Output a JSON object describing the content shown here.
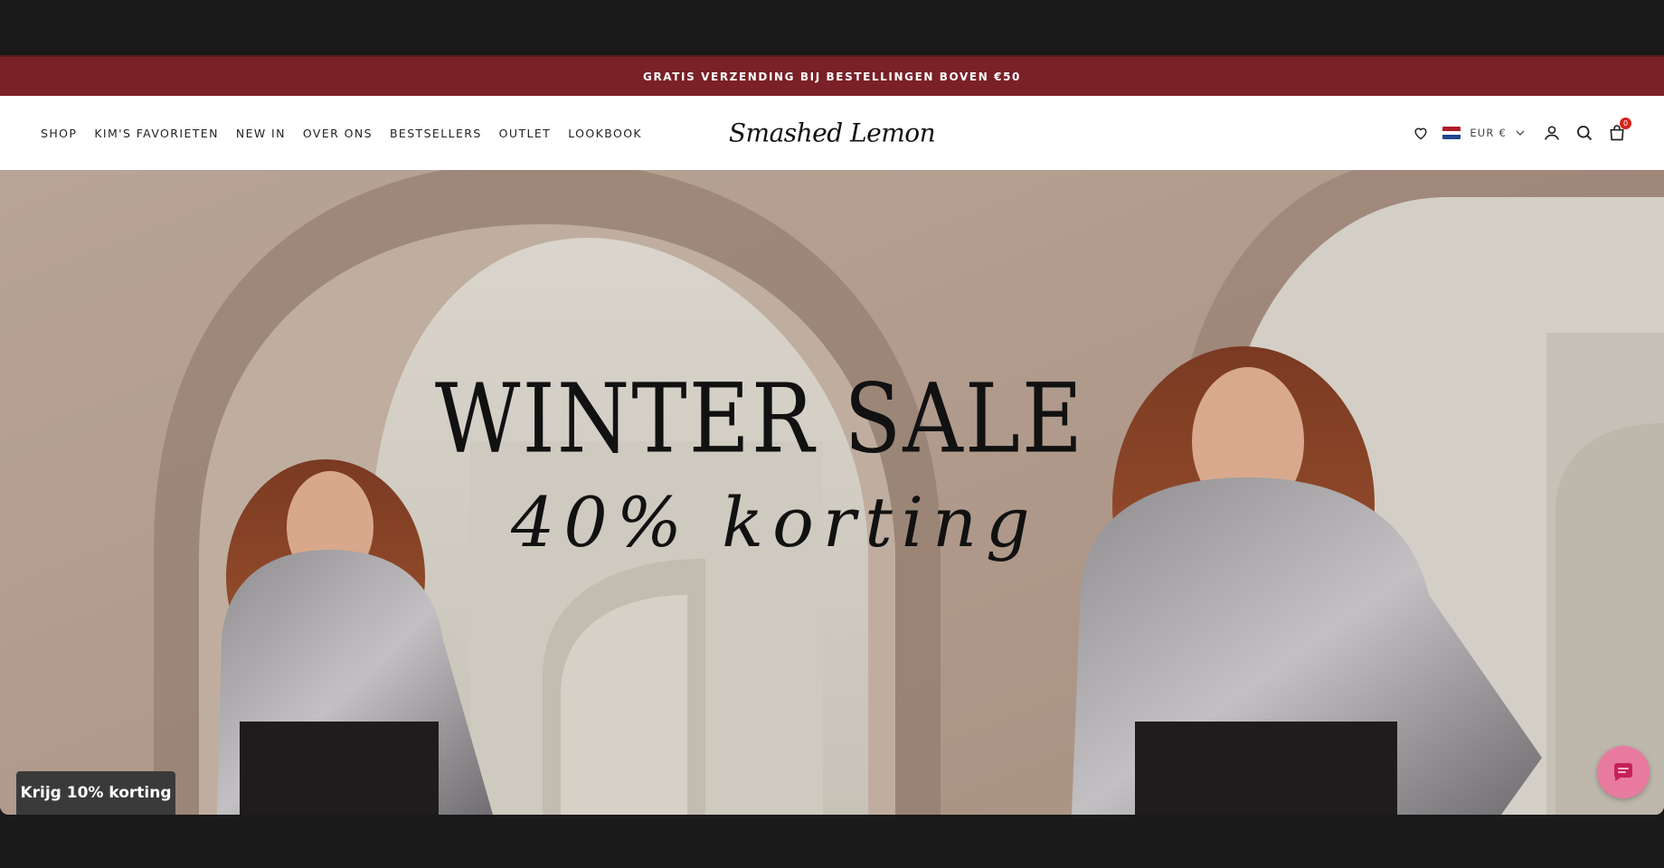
{
  "announcement": {
    "text": "GRATIS VERZENDING BIJ BESTELLINGEN BOVEN €50"
  },
  "nav": {
    "items": [
      {
        "label": "SHOP"
      },
      {
        "label": "KIM'S FAVORIETEN"
      },
      {
        "label": "NEW IN"
      },
      {
        "label": "OVER ONS"
      },
      {
        "label": "BESTSELLERS"
      },
      {
        "label": "OUTLET"
      },
      {
        "label": "LOOKBOOK"
      }
    ]
  },
  "brand": {
    "logo_text": "Smashed Lemon"
  },
  "tools": {
    "wishlist_icon": "heart-icon",
    "currency_label": "EUR €",
    "flag": "netherlands-flag",
    "account_icon": "user-icon",
    "search_icon": "search-icon",
    "cart_icon": "bag-icon",
    "cart_count": "0"
  },
  "hero": {
    "title": "WINTER SALE",
    "subtitle": "40% korting"
  },
  "promo_tab": {
    "label": "Krijg 10% korting"
  },
  "chat": {
    "icon": "chat-icon"
  },
  "colors": {
    "announcement_bg": "#7a2027",
    "badge": "#d4241c",
    "chat_bg": "#e87aa0",
    "promo_bg": "#3a3a3a"
  }
}
